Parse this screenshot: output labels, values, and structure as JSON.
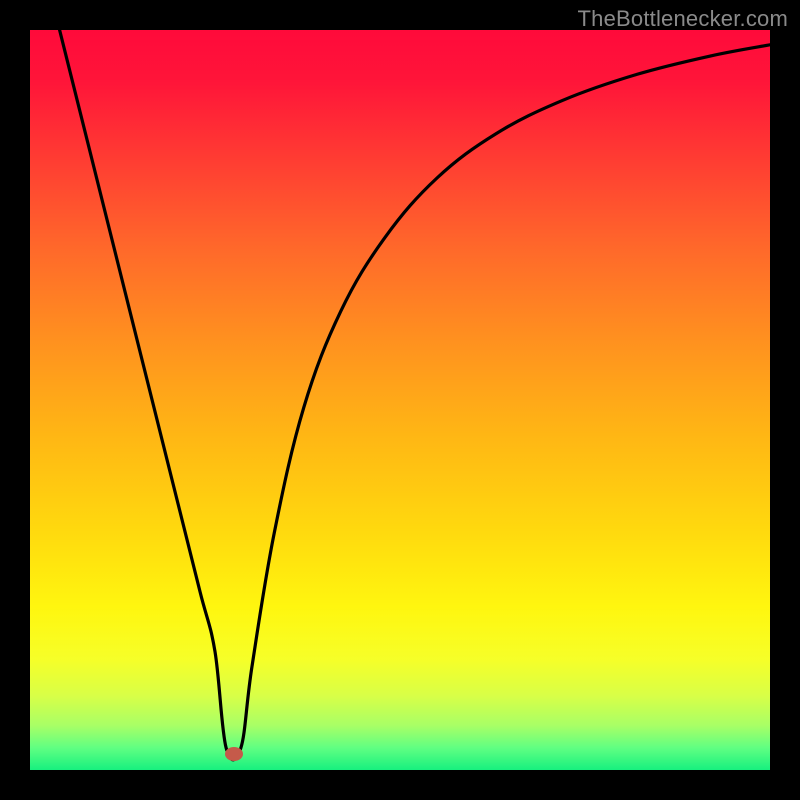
{
  "attribution": "TheBottlenecker.com",
  "gradient_stops": [
    {
      "offset": 0.0,
      "color": "#ff0a3a"
    },
    {
      "offset": 0.07,
      "color": "#ff1539"
    },
    {
      "offset": 0.18,
      "color": "#ff3e32"
    },
    {
      "offset": 0.3,
      "color": "#ff6a2a"
    },
    {
      "offset": 0.42,
      "color": "#ff911f"
    },
    {
      "offset": 0.55,
      "color": "#ffb714"
    },
    {
      "offset": 0.68,
      "color": "#ffda0e"
    },
    {
      "offset": 0.78,
      "color": "#fff60f"
    },
    {
      "offset": 0.85,
      "color": "#f6ff28"
    },
    {
      "offset": 0.9,
      "color": "#d8ff47"
    },
    {
      "offset": 0.94,
      "color": "#a8ff66"
    },
    {
      "offset": 0.97,
      "color": "#60ff82"
    },
    {
      "offset": 1.0,
      "color": "#17f07f"
    }
  ],
  "chart_data": {
    "type": "line",
    "title": "",
    "xlabel": "",
    "ylabel": "",
    "xlim": [
      0,
      100
    ],
    "ylim": [
      0,
      100
    ],
    "grid": false,
    "legend": false,
    "series": [
      {
        "name": "curve",
        "x": [
          4,
          10,
          15,
          20,
          23,
          25,
          26.5,
          28.5,
          30,
          33,
          37,
          42,
          48,
          55,
          63,
          72,
          82,
          92,
          100
        ],
        "y": [
          100,
          76,
          56,
          36,
          24,
          16,
          3,
          3,
          14,
          32,
          49,
          62,
          72,
          80,
          86,
          90.5,
          94,
          96.5,
          98
        ]
      }
    ],
    "marker": {
      "x": 27.5,
      "y": 2.2,
      "color": "#c55a4a"
    }
  }
}
